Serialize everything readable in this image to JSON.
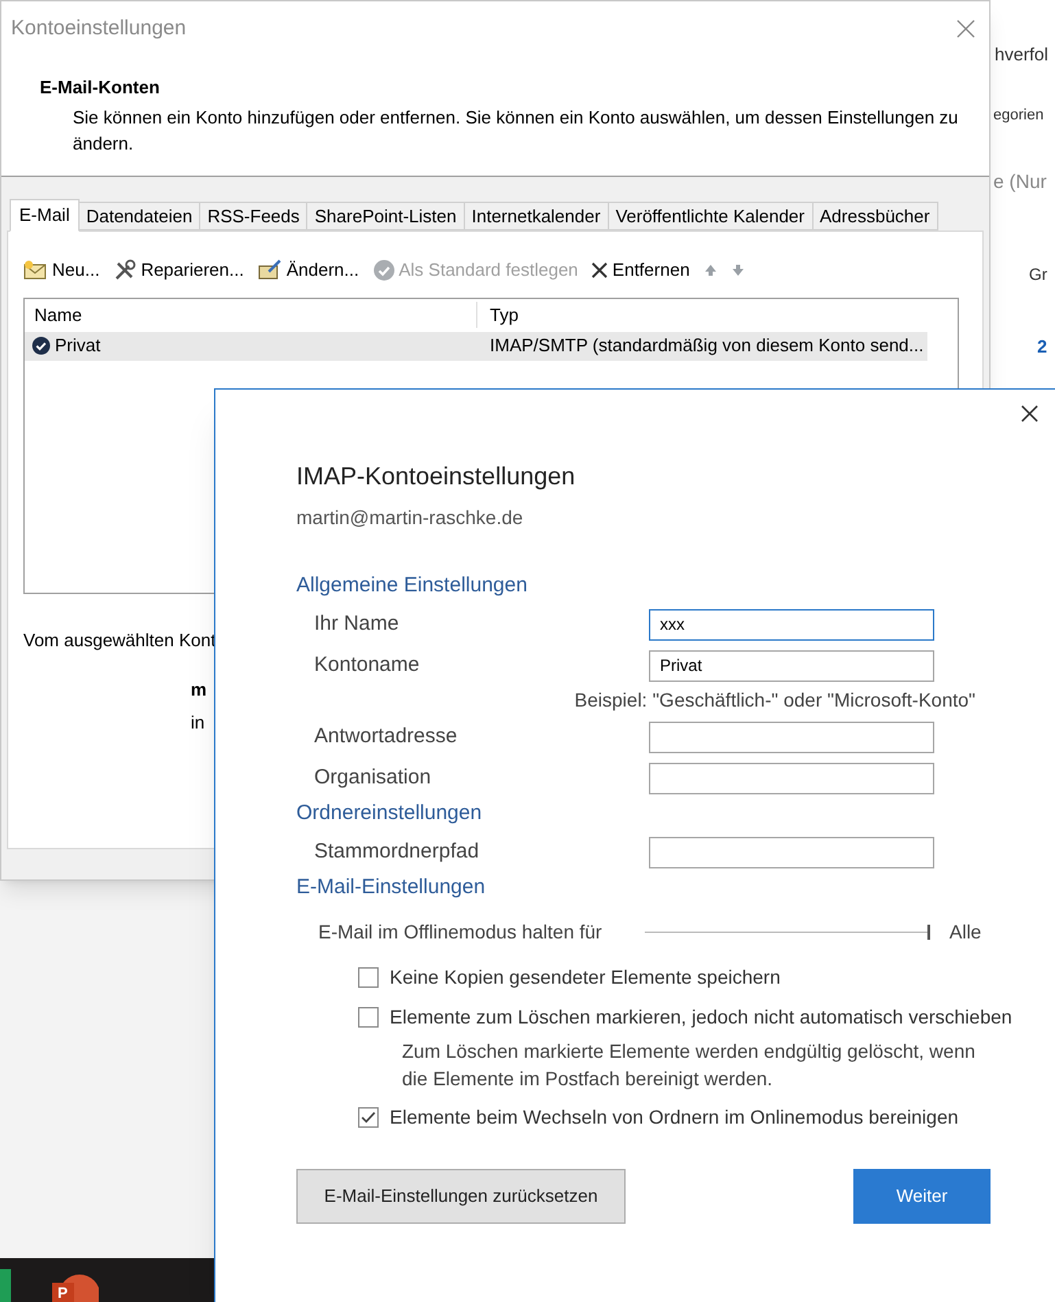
{
  "background": {
    "fragments": [
      "hverfol",
      "egorien",
      "e (Nur",
      "Gr",
      "2"
    ]
  },
  "taskbar": {
    "presentation_letter": "P"
  },
  "account_settings": {
    "title": "Kontoeinstellungen",
    "heading": "E-Mail-Konten",
    "description": "Sie können ein Konto hinzufügen oder entfernen. Sie können ein Konto auswählen, um dessen Einstellungen zu ändern.",
    "tabs": [
      {
        "label": "E-Mail",
        "selected": true
      },
      {
        "label": "Datendateien",
        "selected": false
      },
      {
        "label": "RSS-Feeds",
        "selected": false
      },
      {
        "label": "SharePoint-Listen",
        "selected": false
      },
      {
        "label": "Internetkalender",
        "selected": false
      },
      {
        "label": "Veröffentlichte Kalender",
        "selected": false
      },
      {
        "label": "Adressbücher",
        "selected": false
      }
    ],
    "toolbar": [
      {
        "kind": "new",
        "label": "Neu...",
        "disabled": false
      },
      {
        "kind": "repair",
        "label": "Reparieren...",
        "disabled": false
      },
      {
        "kind": "change",
        "label": "Ändern...",
        "disabled": false
      },
      {
        "kind": "default",
        "label": "Als Standard festlegen",
        "disabled": true
      },
      {
        "kind": "remove",
        "label": "Entfernen",
        "disabled": false
      },
      {
        "kind": "up",
        "disabled": true
      },
      {
        "kind": "down",
        "disabled": true
      }
    ],
    "table": {
      "columns": [
        "Name",
        "Typ"
      ],
      "rows": [
        {
          "name": "Privat",
          "type": "IMAP/SMTP (standardmäßig von diesem Konto send...",
          "selected": true
        }
      ]
    },
    "footer_text": "Vom ausgewählten Kont",
    "footer_bold": "m",
    "footer_line": "in"
  },
  "imap_dialog": {
    "title": "IMAP-Kontoeinstellungen",
    "email": "martin@martin-raschke.de",
    "sections": [
      {
        "heading": "Allgemeine Einstellungen",
        "items": [
          {
            "kind": "field",
            "label": "Ihr Name",
            "value": "xxx",
            "focused": true
          },
          {
            "kind": "field",
            "label": "Kontoname",
            "value": "Privat",
            "focused": false
          },
          {
            "kind": "hint",
            "text": "Beispiel: \"Geschäftlich-\" oder \"Microsoft-Konto\""
          },
          {
            "kind": "field",
            "label": "Antwortadresse",
            "value": "",
            "focused": false
          },
          {
            "kind": "field",
            "label": "Organisation",
            "value": "",
            "focused": false
          }
        ]
      },
      {
        "heading": "Ordnereinstellungen",
        "items": [
          {
            "kind": "field",
            "label": "Stammordnerpfad",
            "value": "",
            "focused": false
          }
        ]
      },
      {
        "heading": "E-Mail-Einstellungen",
        "items": [
          {
            "kind": "slider",
            "label": "E-Mail im Offlinemodus halten für",
            "level": 1,
            "reading": "Alle"
          },
          {
            "kind": "checkbox",
            "label": "Keine Kopien gesendeter Elemente speichern",
            "checked": false
          },
          {
            "kind": "checkbox",
            "label": "Elemente zum Löschen markieren, jedoch nicht automatisch verschieben",
            "checked": false
          },
          {
            "kind": "note",
            "text": "Zum Löschen markierte Elemente werden endgültig gelöscht, wenn die Elemente im Postfach bereinigt werden."
          },
          {
            "kind": "checkbox",
            "label": "Elemente beim Wechseln von Ordnern im Onlinemodus bereinigen",
            "checked": true
          }
        ]
      }
    ],
    "buttons": [
      {
        "kind": "secondary",
        "label": "E-Mail-Einstellungen zurücksetzen"
      },
      {
        "kind": "primary",
        "label": "Weiter"
      }
    ]
  }
}
